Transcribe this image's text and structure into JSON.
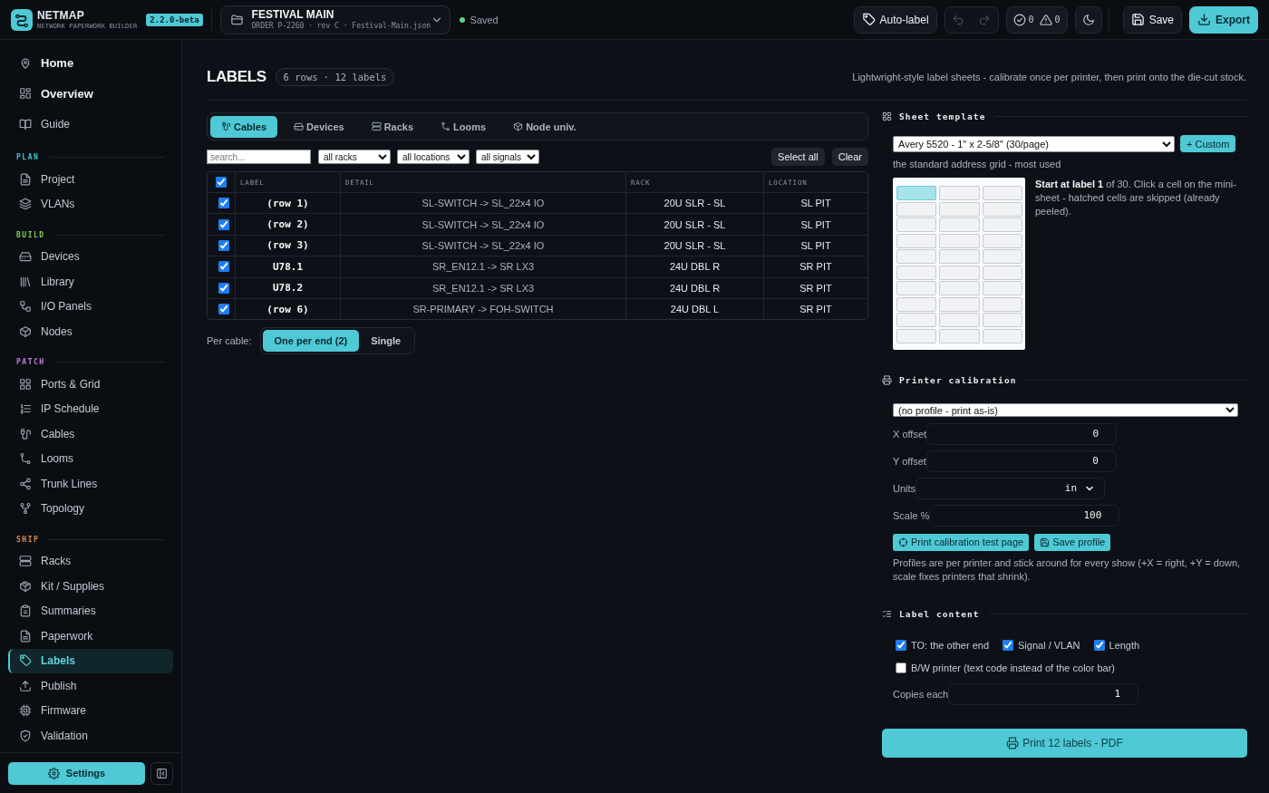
{
  "app": {
    "name": "NETMAP",
    "subtitle": "NETWORK PAPERWORK BUILDER",
    "version": "2.2.0-beta"
  },
  "project": {
    "title": "FESTIVAL MAIN",
    "meta": "ORDER P-2260 · rev C · Festival-Main.json"
  },
  "save_status": "Saved",
  "toolbar": {
    "auto_label": "Auto-label",
    "undo": {
      "disabled": true
    },
    "redo": {
      "disabled": true
    },
    "passed": "0",
    "warnings": "0",
    "save": "Save",
    "export": "Export"
  },
  "sidebar": {
    "top_items": [
      {
        "label": "Home",
        "kind": "main",
        "selected": false
      },
      {
        "label": "Overview",
        "kind": "main",
        "selected": false
      },
      {
        "label": "Guide",
        "kind": "plain",
        "selected": false
      }
    ],
    "sections": [
      {
        "title": "PLAN",
        "color": "#3fc4d0",
        "items": [
          {
            "label": "Project",
            "selected": false
          },
          {
            "label": "VLANs",
            "selected": false
          }
        ]
      },
      {
        "title": "BUILD",
        "color": "#7fcf5c",
        "items": [
          {
            "label": "Devices",
            "selected": false
          },
          {
            "label": "Library",
            "selected": false
          },
          {
            "label": "I/O Panels",
            "selected": false
          },
          {
            "label": "Nodes",
            "selected": false
          }
        ]
      },
      {
        "title": "PATCH",
        "color": "#c77ad6",
        "items": [
          {
            "label": "Ports & Grid",
            "selected": false
          },
          {
            "label": "IP Schedule",
            "selected": false
          },
          {
            "label": "Cables",
            "selected": false
          },
          {
            "label": "Looms",
            "selected": false
          },
          {
            "label": "Trunk Lines",
            "selected": false
          },
          {
            "label": "Topology",
            "selected": false
          }
        ]
      },
      {
        "title": "SHIP",
        "color": "#e08c4c",
        "items": [
          {
            "label": "Racks",
            "selected": false
          },
          {
            "label": "Kit / Supplies",
            "selected": false
          },
          {
            "label": "Summaries",
            "selected": false
          },
          {
            "label": "Paperwork",
            "selected": false
          },
          {
            "label": "Labels",
            "selected": true
          },
          {
            "label": "Publish",
            "selected": false
          },
          {
            "label": "Firmware",
            "selected": false
          },
          {
            "label": "Validation",
            "selected": false
          }
        ]
      }
    ],
    "settings": "Settings"
  },
  "page": {
    "title": "LABELS",
    "summary": "6 rows · 12 labels",
    "description": "Lightwright-style label sheets - calibrate once per printer, then print onto the die-cut stock."
  },
  "tabs": [
    {
      "label": "Cables",
      "selected": true
    },
    {
      "label": "Devices",
      "selected": false
    },
    {
      "label": "Racks",
      "selected": false
    },
    {
      "label": "Looms",
      "selected": false
    },
    {
      "label": "Node univ.",
      "selected": false
    }
  ],
  "filters": {
    "search": {
      "placeholder": "search..."
    },
    "dropdowns": [
      "all racks",
      "all locations",
      "all signals"
    ],
    "select_all": "Select all",
    "clear": "Clear"
  },
  "table": {
    "all_checked": true,
    "columns": [
      "LABEL",
      "DETAIL",
      "RACK",
      "LOCATION"
    ],
    "rows": [
      {
        "checked": true,
        "cells": [
          "(row 1)",
          "SL-SWITCH -> SL_22x4 IO",
          "20U SLR - SL",
          "SL PIT"
        ]
      },
      {
        "checked": true,
        "cells": [
          "(row 2)",
          "SL-SWITCH -> SL_22x4 IO",
          "20U SLR - SL",
          "SL PIT"
        ]
      },
      {
        "checked": true,
        "cells": [
          "(row 3)",
          "SL-SWITCH -> SL_22x4 IO",
          "20U SLR - SL",
          "SL PIT"
        ]
      },
      {
        "checked": true,
        "cells": [
          "U78.1",
          "SR_EN12.1 -> SR LX3",
          "24U DBL R",
          "SR PIT"
        ]
      },
      {
        "checked": true,
        "cells": [
          "U78.2",
          "SR_EN12.1 -> SR LX3",
          "24U DBL R",
          "SR PIT"
        ]
      },
      {
        "checked": true,
        "cells": [
          "(row 6)",
          "SR-PRIMARY -> FOH-SWITCH",
          "24U DBL L",
          "SR PIT"
        ]
      }
    ]
  },
  "per_cable": {
    "label": "Per cable:",
    "options": [
      {
        "label": "One per end (2)",
        "selected": true
      },
      {
        "label": "Single",
        "selected": false
      }
    ]
  },
  "sheet_template": {
    "title": "Sheet template",
    "template": "Avery 5520 - 1\" x 2-5/8\" (30/page)",
    "custom": "+ Custom",
    "hint": "the standard address grid - most used",
    "cells": [
      {
        "selected": true
      },
      {
        "selected": false
      },
      {
        "selected": false
      },
      {
        "selected": false
      },
      {
        "selected": false
      },
      {
        "selected": false
      },
      {
        "selected": false
      },
      {
        "selected": false
      },
      {
        "selected": false
      },
      {
        "selected": false
      },
      {
        "selected": false
      },
      {
        "selected": false
      },
      {
        "selected": false
      },
      {
        "selected": false
      },
      {
        "selected": false
      },
      {
        "selected": false
      },
      {
        "selected": false
      },
      {
        "selected": false
      },
      {
        "selected": false
      },
      {
        "selected": false
      },
      {
        "selected": false
      },
      {
        "selected": false
      },
      {
        "selected": false
      },
      {
        "selected": false
      },
      {
        "selected": false
      },
      {
        "selected": false
      },
      {
        "selected": false
      },
      {
        "selected": false
      },
      {
        "selected": false
      },
      {
        "selected": false
      }
    ],
    "info": "**Start at label 1** of 30. Click a cell on the mini-sheet - hatched cells are skipped (already peeled)."
  },
  "calibration": {
    "title": "Printer calibration",
    "profile": "(no profile - print as-is)",
    "fields": [
      {
        "kind": "number",
        "label": "X offset",
        "value": "0"
      },
      {
        "kind": "number",
        "label": "Y offset",
        "value": "0"
      },
      {
        "kind": "select",
        "label": "Units",
        "value": "in"
      },
      {
        "kind": "number",
        "label": "Scale %",
        "value": "100"
      }
    ],
    "test_button": "Print calibration test page",
    "save_button": "Save profile",
    "note": "Profiles are per printer and stick around for every show (+X = right, +Y = down, scale fixes printers that shrink)."
  },
  "label_content": {
    "title": "Label content",
    "option_rows": [
      {
        "options": [
          {
            "label": "TO: the other end",
            "checked": true
          },
          {
            "label": "Signal / VLAN",
            "checked": true
          },
          {
            "label": "Length",
            "checked": true
          }
        ]
      },
      {
        "options": [
          {
            "label": "B/W printer (text code instead of the color bar)",
            "checked": false
          }
        ]
      }
    ],
    "copies_label": "Copies each",
    "copies": "1"
  },
  "print_button": "Print 12 labels - PDF"
}
